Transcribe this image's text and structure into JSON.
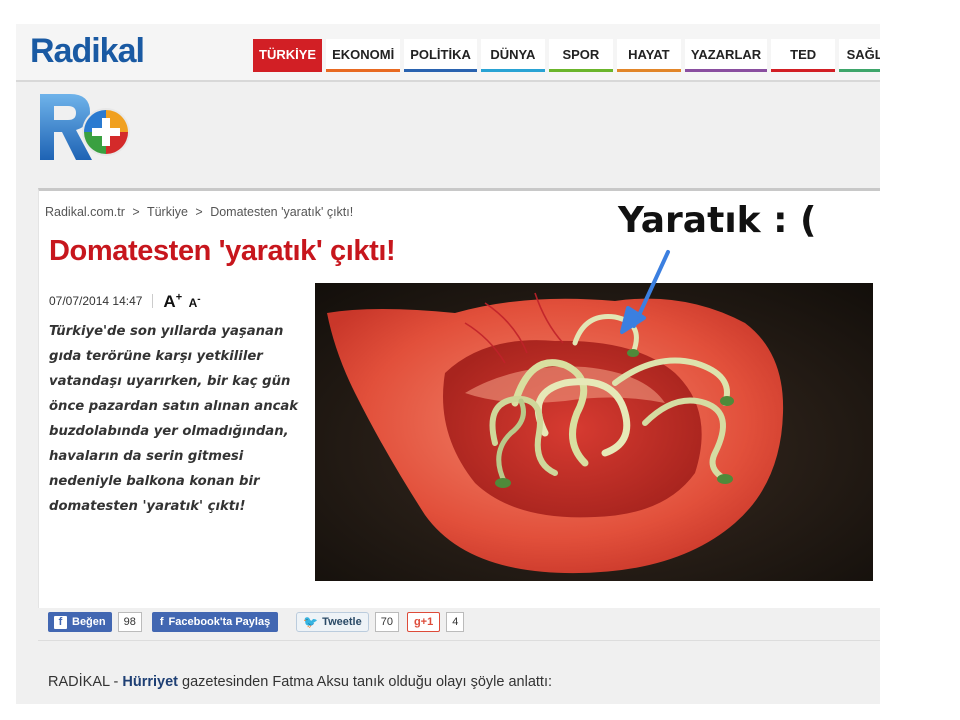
{
  "site": {
    "logo": "Radikal",
    "nav": [
      "TÜRKİYE",
      "EKONOMİ",
      "POLİTİKA",
      "DÜNYA",
      "SPOR",
      "HAYAT",
      "YAZARLAR",
      "TED",
      "SAĞLIK"
    ],
    "nav_active": "TÜRKİYE",
    "nav_colors": [
      "#d21f25",
      "#e86a22",
      "#2a63b0",
      "#29a3d4",
      "#6bb52c",
      "#e2862a",
      "#8a4fa0",
      "#d21f25",
      "#3ea66b"
    ]
  },
  "breadcrumb": [
    "Radikal.com.tr",
    ">",
    "Türkiye",
    ">",
    "Domatesten 'yaratık' çıktı!"
  ],
  "article": {
    "title": "Domatesten 'yaratık' çıktı!",
    "date": "07/07/2014 14:47",
    "font_increase": "A",
    "font_increase_sup": "+",
    "font_decrease": "A",
    "font_decrease_sup": "-",
    "lead_lines": [
      "Türkiye'de son yıllarda yaşanan",
      "gıda terörüne karşı yetkililer",
      "vatandaşı uyarırken, bir kaç gün",
      "önce pazardan satın alınan ancak",
      "buzdolabında yer olmadığından,",
      "havaların da serin gitmesi",
      "nedeniyle balkona konan bir",
      "domatesten 'yaratık' çıktı!"
    ]
  },
  "social": {
    "like_label": "Beğen",
    "like_count": "98",
    "share_label": "Facebook'ta Paylaş",
    "tweet_label": "Tweetle",
    "tweet_count": "70",
    "gplus_label": "g+1",
    "gplus_count": "4"
  },
  "byline": {
    "prefix": "RADİKAL - ",
    "source": "Hürriyet",
    "rest": " gazetesinden Fatma Aksu tanık olduğu olayı şöyle anlattı:"
  },
  "annotation": {
    "text": "Yaratık : (",
    "arrow_color": "#3b7fe0"
  }
}
